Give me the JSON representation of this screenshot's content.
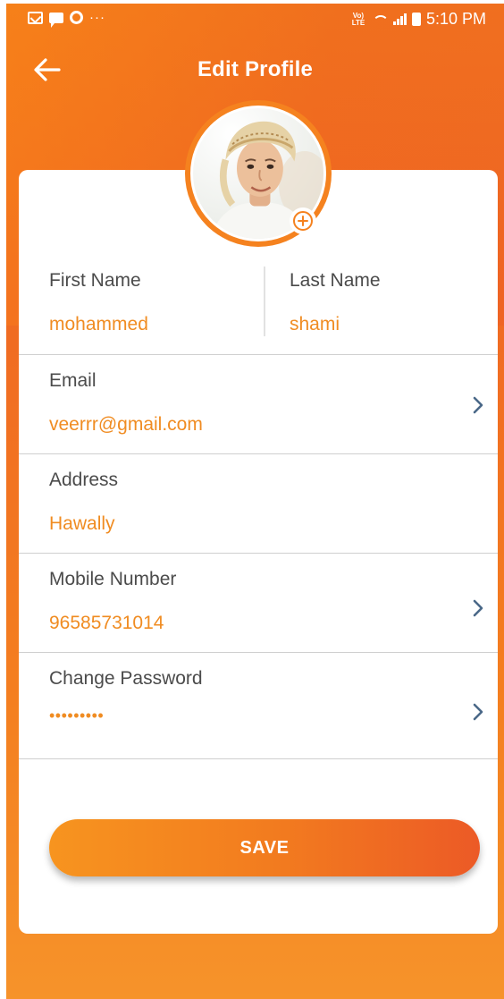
{
  "status_bar": {
    "more_indicator": "···",
    "network_label": "Vo) LTE",
    "time": "5:10 PM"
  },
  "header": {
    "title": "Edit Profile",
    "back_icon": "arrow-left-icon"
  },
  "avatar": {
    "add_icon": "plus-circle-icon"
  },
  "form": {
    "first_name": {
      "label": "First Name",
      "value": "mohammed"
    },
    "last_name": {
      "label": "Last Name",
      "value": "shami"
    },
    "email": {
      "label": "Email",
      "value": "veerrr@gmail.com"
    },
    "address": {
      "label": "Address",
      "value": "Hawally"
    },
    "mobile": {
      "label": "Mobile Number",
      "value": "96585731014"
    },
    "password": {
      "label": "Change Password",
      "value": "•••••••••"
    }
  },
  "actions": {
    "save_label": "SAVE"
  },
  "colors": {
    "accent": "#f5821f",
    "value_text": "#f08c22",
    "chevron": "#4a6888"
  }
}
